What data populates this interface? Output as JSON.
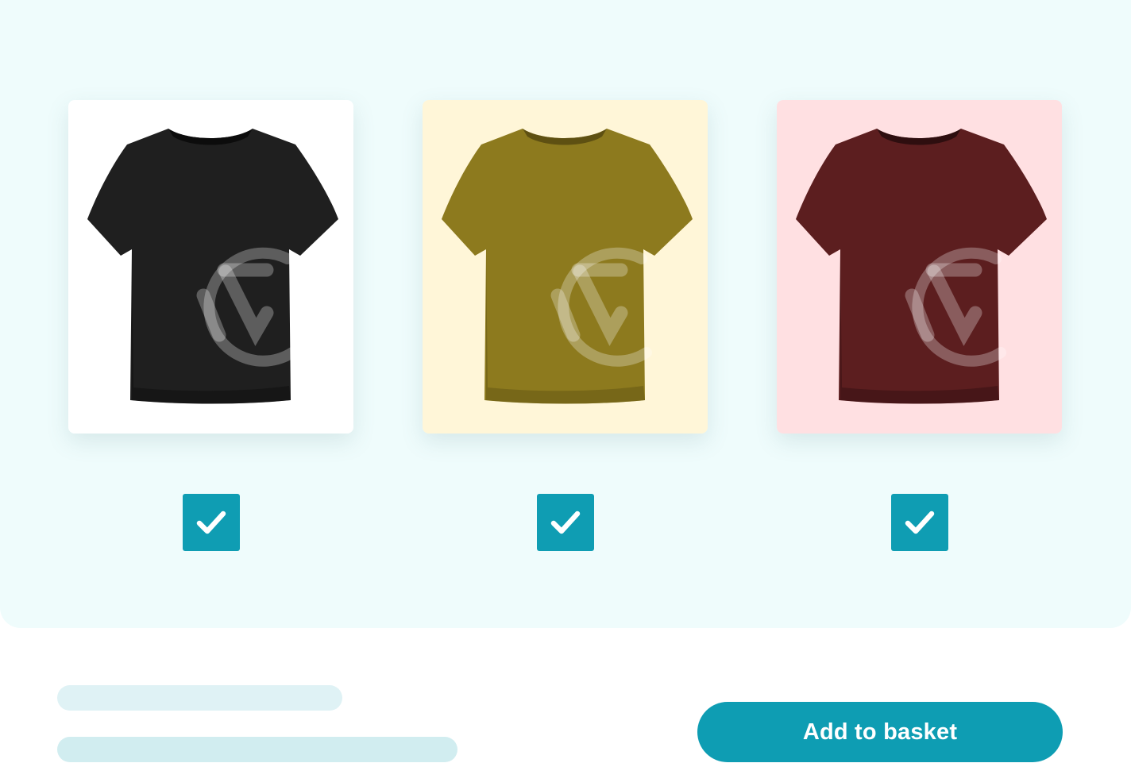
{
  "products": [
    {
      "color_name": "black",
      "card_bg": "#ffffff",
      "shirt_color": "#1f1f1f",
      "shirt_shade": "#0c0c0c",
      "selected": true
    },
    {
      "color_name": "olive",
      "card_bg": "#fff6d8",
      "shirt_color": "#8d7a1e",
      "shirt_shade": "#5e5012",
      "selected": true
    },
    {
      "color_name": "maroon",
      "card_bg": "#ffe0e2",
      "shirt_color": "#5c1e1f",
      "shirt_shade": "#2e0e0f",
      "selected": true
    }
  ],
  "checkbox_icon": "check-icon",
  "watermark_icon": "logo-watermark-icon",
  "placeholder_lines": [
    {
      "color": "#dff2f5",
      "fill_fraction": 0.25
    },
    {
      "color": "#d1edf0",
      "fill_fraction": 0.35
    }
  ],
  "actions": {
    "add_to_basket_label": "Add to basket"
  },
  "colors": {
    "accent": "#0e9db3",
    "panel_bg": "#effcfc"
  }
}
